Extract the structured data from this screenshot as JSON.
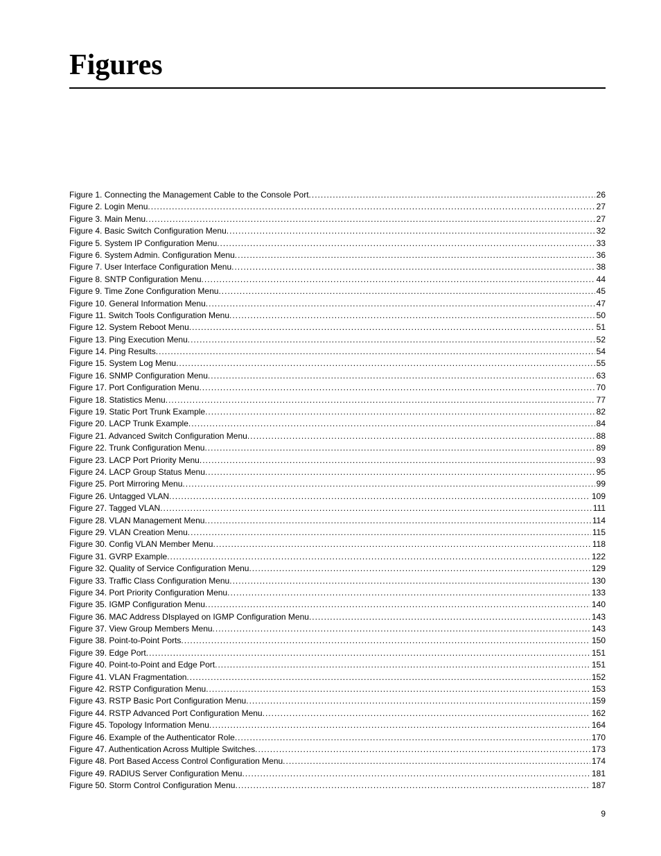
{
  "title": "Figures",
  "pageNumber": "9",
  "figures": [
    {
      "num": "1",
      "title": "Connecting the Management Cable to the Console Port",
      "page": "26"
    },
    {
      "num": "2",
      "title": "Login Menu",
      "page": "27"
    },
    {
      "num": "3",
      "title": "Main Menu",
      "page": "27"
    },
    {
      "num": "4",
      "title": "Basic Switch Configuration Menu",
      "page": "32"
    },
    {
      "num": "5",
      "title": "System IP Configuration Menu",
      "page": "33"
    },
    {
      "num": "6",
      "title": "System Admin. Configuration Menu",
      "page": "36"
    },
    {
      "num": "7",
      "title": "User Interface Configuration Menu",
      "page": "38"
    },
    {
      "num": "8",
      "title": "SNTP Configuration Menu",
      "page": "44"
    },
    {
      "num": "9",
      "title": "Time Zone Configuration Menu",
      "page": "45"
    },
    {
      "num": "10",
      "title": "General Information Menu",
      "page": "47"
    },
    {
      "num": "11",
      "title": "Switch Tools Configuration Menu",
      "page": "50"
    },
    {
      "num": "12",
      "title": "System Reboot Menu",
      "page": "51"
    },
    {
      "num": "13",
      "title": "Ping Execution Menu",
      "page": "52"
    },
    {
      "num": "14",
      "title": "Ping Results",
      "page": "54"
    },
    {
      "num": "15",
      "title": "System Log Menu",
      "page": "55"
    },
    {
      "num": "16",
      "title": "SNMP Configuration Menu",
      "page": "63"
    },
    {
      "num": "17",
      "title": "Port Configuration Menu",
      "page": "70"
    },
    {
      "num": "18",
      "title": "Statistics Menu",
      "page": "77"
    },
    {
      "num": "19",
      "title": "Static Port Trunk Example",
      "page": "82"
    },
    {
      "num": "20",
      "title": "LACP Trunk Example",
      "page": "84"
    },
    {
      "num": "21",
      "title": "Advanced Switch Configuration Menu",
      "page": "88"
    },
    {
      "num": "22",
      "title": "Trunk Configuration Menu",
      "page": "89"
    },
    {
      "num": "23",
      "title": "LACP Port Priority Menu",
      "page": "93"
    },
    {
      "num": "24",
      "title": "LACP Group Status Menu",
      "page": "95"
    },
    {
      "num": "25",
      "title": "Port Mirroring Menu",
      "page": "99"
    },
    {
      "num": "26",
      "title": "Untagged VLAN",
      "page": "109"
    },
    {
      "num": "27",
      "title": "Tagged VLAN",
      "page": "111"
    },
    {
      "num": "28",
      "title": "VLAN Management Menu",
      "page": "114"
    },
    {
      "num": "29",
      "title": "VLAN Creation Menu",
      "page": "115"
    },
    {
      "num": "30",
      "title": "Config VLAN Member Menu",
      "page": "118"
    },
    {
      "num": "31",
      "title": "GVRP Example",
      "page": "122"
    },
    {
      "num": "32",
      "title": "Quality of Service Configuration Menu",
      "page": "129"
    },
    {
      "num": "33",
      "title": "Traffic Class Configuration Menu",
      "page": "130"
    },
    {
      "num": "34",
      "title": "Port Priority Configuration Menu",
      "page": "133"
    },
    {
      "num": "35",
      "title": "IGMP Configuration Menu",
      "page": "140"
    },
    {
      "num": "36",
      "title": "MAC Address DIsplayed on IGMP Configuration Menu",
      "page": "143"
    },
    {
      "num": "37",
      "title": "View Group Members Menu",
      "page": "143"
    },
    {
      "num": "38",
      "title": "Point-to-Point Ports",
      "page": "150"
    },
    {
      "num": "39",
      "title": "Edge Port",
      "page": "151"
    },
    {
      "num": "40",
      "title": "Point-to-Point and Edge Port",
      "page": "151"
    },
    {
      "num": "41",
      "title": "VLAN Fragmentation",
      "page": "152"
    },
    {
      "num": "42",
      "title": "RSTP Configuration Menu",
      "page": "153"
    },
    {
      "num": "43",
      "title": "RSTP Basic Port Configuration Menu",
      "page": "159"
    },
    {
      "num": "44",
      "title": "RSTP Advanced Port Configuration Menu",
      "page": "162"
    },
    {
      "num": "45",
      "title": "Topology Information Menu",
      "page": "164"
    },
    {
      "num": "46",
      "title": "Example of the Authenticator Role",
      "page": "170"
    },
    {
      "num": "47",
      "title": "Authentication Across Multiple Switches",
      "page": "173"
    },
    {
      "num": "48",
      "title": "Port Based Access Control Configuration Menu",
      "page": "174"
    },
    {
      "num": "49",
      "title": "RADIUS Server Configuration Menu",
      "page": "181"
    },
    {
      "num": "50",
      "title": "Storm Control Configuration Menu",
      "page": "187"
    }
  ]
}
